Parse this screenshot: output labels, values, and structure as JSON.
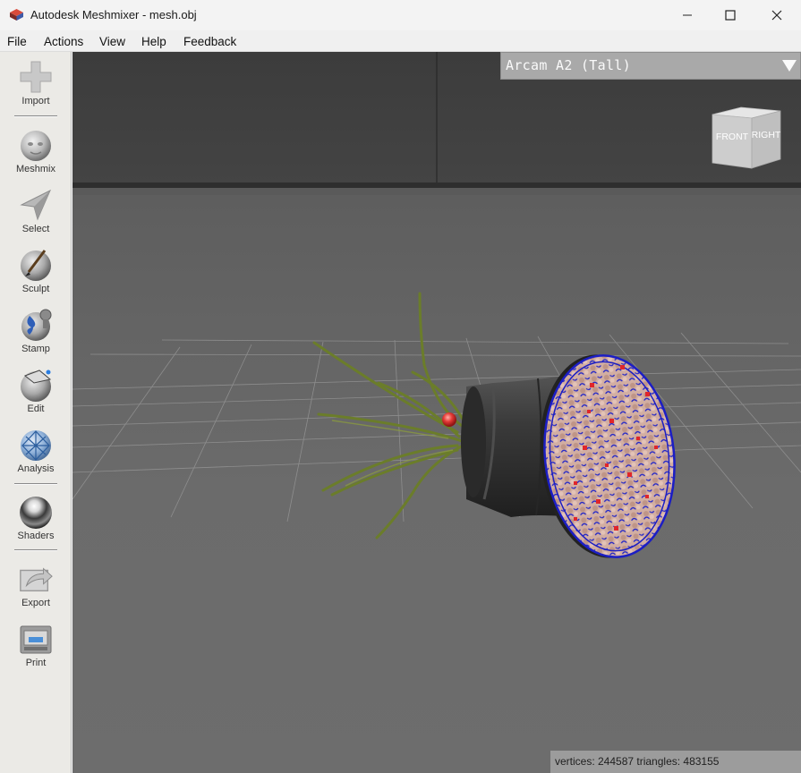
{
  "window": {
    "title": "Autodesk Meshmixer - mesh.obj",
    "app_icon": "meshmixer-logo-icon",
    "controls": [
      "minimize-icon",
      "maximize-icon",
      "close-icon"
    ]
  },
  "menu": {
    "items": [
      "File",
      "Actions",
      "View",
      "Help",
      "Feedback"
    ]
  },
  "toolbar": {
    "tools": [
      {
        "label": "Import",
        "icon": "plus-icon"
      },
      {
        "label": "Meshmix",
        "icon": "bunny-head-icon"
      },
      {
        "label": "Select",
        "icon": "arrow-cursor-icon"
      },
      {
        "label": "Sculpt",
        "icon": "brush-sphere-icon"
      },
      {
        "label": "Stamp",
        "icon": "stamp-icon"
      },
      {
        "label": "Edit",
        "icon": "edit-sphere-icon"
      },
      {
        "label": "Analysis",
        "icon": "analysis-sphere-icon"
      },
      {
        "label": "Shaders",
        "icon": "chrome-sphere-icon"
      },
      {
        "label": "Export",
        "icon": "export-icon"
      },
      {
        "label": "Print",
        "icon": "printer-icon"
      }
    ]
  },
  "viewport": {
    "printer": "Arcam A2 (Tall)",
    "nav_cube": {
      "front": "FRONT",
      "right": "RIGHT"
    },
    "status": "vertices: 244587 triangles: 483155",
    "colors": {
      "background": "#6a6a6a",
      "grid": "#9a9a9a",
      "mesh_dark": "#2e2e2e",
      "mesh_face": "#c9a69a",
      "boundary": "#1a1acc",
      "error_points": "#e0262b",
      "grass": "#6b7d2a",
      "pivot": "#e33a3a"
    }
  }
}
